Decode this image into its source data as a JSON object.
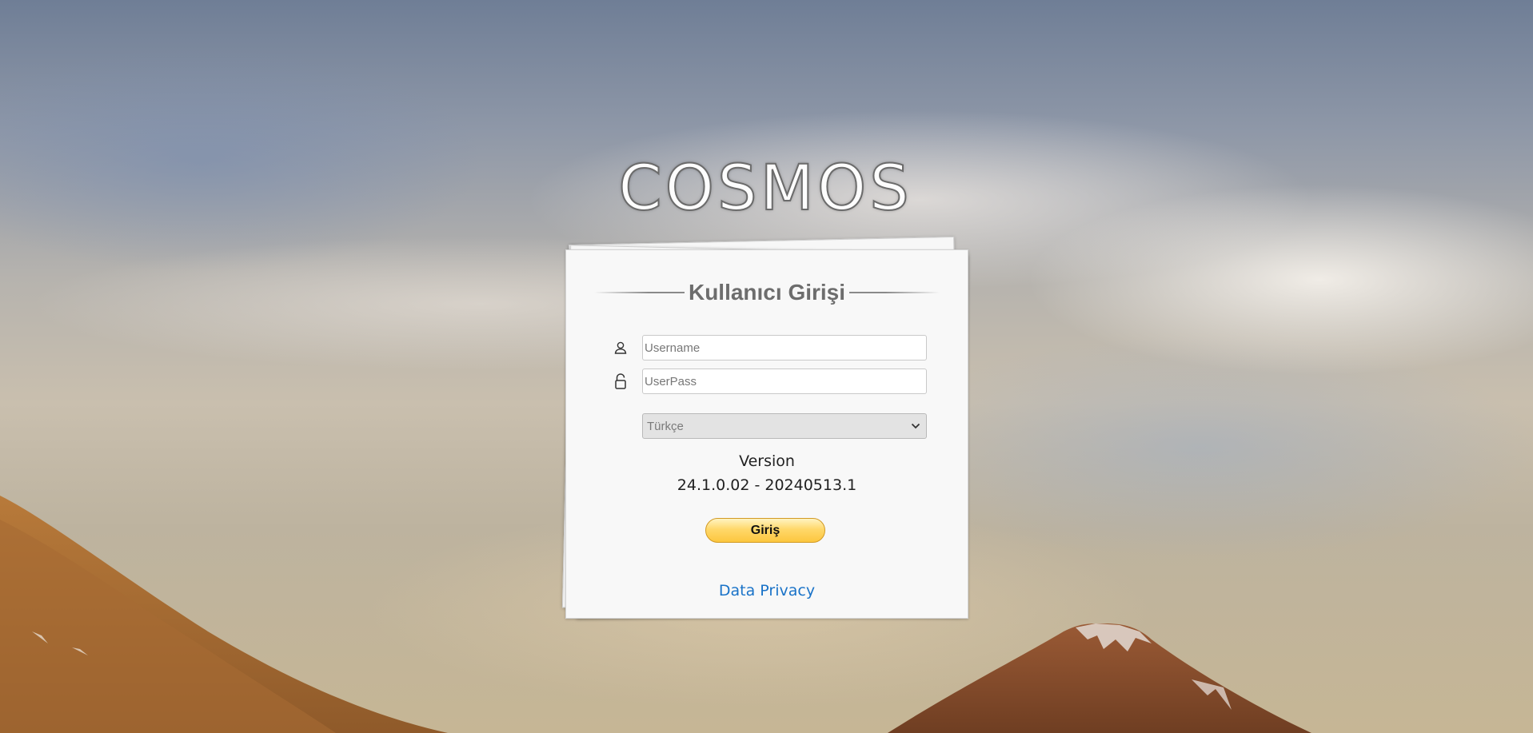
{
  "logo": {
    "text": "COSMOS"
  },
  "login_card": {
    "title": "Kullanıcı Girişi",
    "username": {
      "value": "",
      "placeholder": "Username",
      "icon": "user-icon"
    },
    "password": {
      "value": "",
      "placeholder": "UserPass",
      "icon": "lock-icon"
    },
    "language": {
      "selected": "Türkçe"
    },
    "version_label": "Version",
    "version_value": "24.1.0.02 - 20240513.1",
    "login_button": "Giriş",
    "privacy_link": "Data Privacy"
  },
  "colors": {
    "button_fill": "#ffd86a",
    "link": "#1a73c8",
    "title": "#6d6d6d"
  }
}
